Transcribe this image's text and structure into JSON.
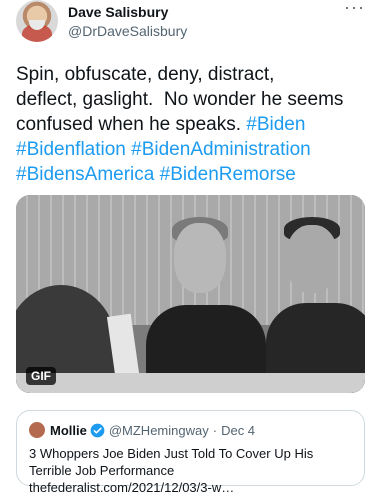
{
  "author": {
    "name": "Dave Salisbury",
    "handle": "@DrDaveSalisbury",
    "more_icon": "more-horizontal-icon"
  },
  "tweet": {
    "text_lines": [
      "Spin, obfuscate, deny, distract,",
      "deflect, gaslight.  No wonder he seems",
      "confused when he speaks. "
    ],
    "hashtags": [
      "#Biden",
      "#Bidenflation",
      "#BidenAdministration",
      "#BidensAmerica",
      "#BidenRemorse"
    ]
  },
  "media": {
    "badge": "GIF"
  },
  "quoted": {
    "name": "Mollie",
    "handle": "@MZHemingway",
    "separator": "·",
    "date": "Dec 4",
    "text": "3 Whoppers Joe Biden Just Told To Cover Up His Terrible Job Performance thefederalist.com/2021/12/03/3-w…"
  },
  "colors": {
    "link": "#1d9bf0",
    "secondary_text": "#536471",
    "verified": "#1d9bf0"
  }
}
